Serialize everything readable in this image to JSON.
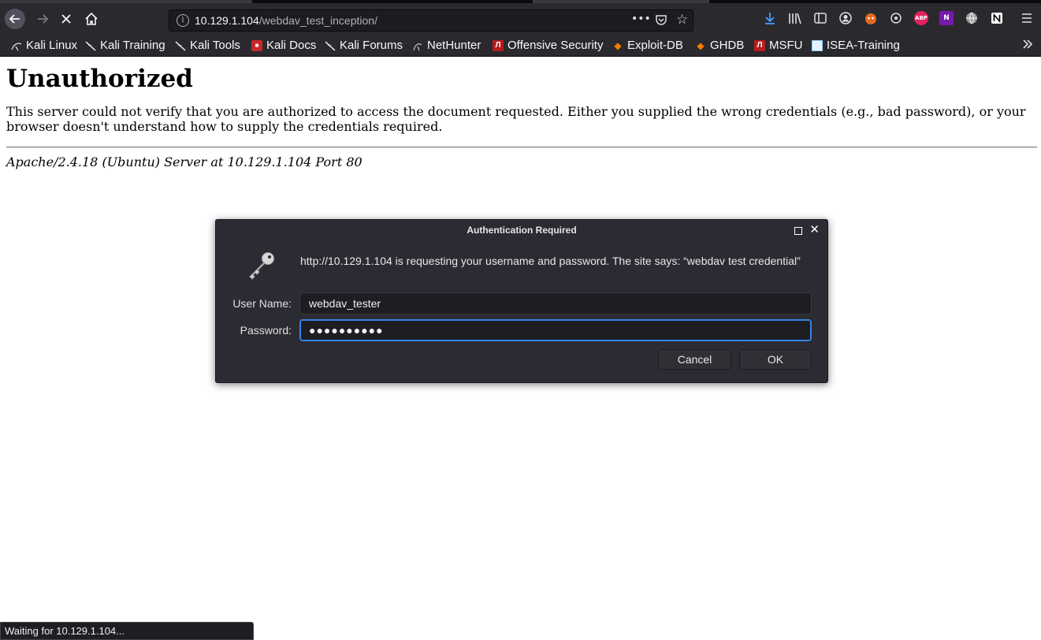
{
  "browser": {
    "url_host": "10.129.1.104",
    "url_path": "/webdav_test_inception/",
    "page_actions_label": "•••"
  },
  "bookmarks": [
    {
      "label": "Kali Linux",
      "icon": "kali-icon"
    },
    {
      "label": "Kali Training",
      "icon": "kali-icon"
    },
    {
      "label": "Kali Tools",
      "icon": "kali-icon"
    },
    {
      "label": "Kali Docs",
      "icon": "kali-docs-icon"
    },
    {
      "label": "Kali Forums",
      "icon": "kali-icon"
    },
    {
      "label": "NetHunter",
      "icon": "nethunter-icon"
    },
    {
      "label": "Offensive Security",
      "icon": "offsec-icon"
    },
    {
      "label": "Exploit-DB",
      "icon": "exploitdb-icon"
    },
    {
      "label": "GHDB",
      "icon": "exploitdb-icon"
    },
    {
      "label": "MSFU",
      "icon": "offsec-icon"
    },
    {
      "label": "ISEA-Training",
      "icon": "isea-icon"
    }
  ],
  "page": {
    "heading": "Unauthorized",
    "body": "This server could not verify that you are authorized to access the document requested. Either you supplied the wrong credentials (e.g., bad password), or your browser doesn't understand how to supply the credentials required.",
    "address": "Apache/2.4.18 (Ubuntu) Server at 10.129.1.104 Port 80"
  },
  "dialog": {
    "title": "Authentication Required",
    "message": "http://10.129.1.104 is requesting your username and password. The site says: “webdav test credential”",
    "username_label": "User Name:",
    "username_value": "webdav_tester",
    "password_label": "Password:",
    "password_value": "●●●●●●●●●●",
    "cancel_label": "Cancel",
    "ok_label": "OK"
  },
  "status_text": "Waiting for 10.129.1.104...",
  "colors": {
    "toolbar": "#2a2a2e",
    "dialog_bg": "#2b2b33",
    "focus": "#3584e4"
  }
}
